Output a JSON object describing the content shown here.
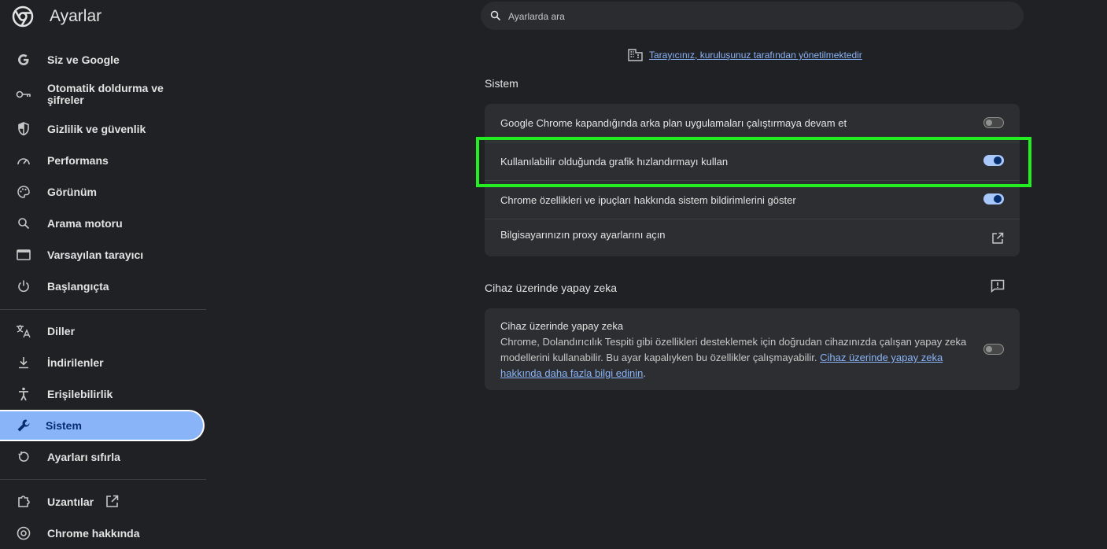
{
  "app": {
    "title": "Ayarlar"
  },
  "search": {
    "placeholder": "Ayarlarda ara"
  },
  "managed_notice": "Tarayıcınız, kuruluşunuz tarafından yönetilmektedir",
  "sidebar": {
    "items": [
      {
        "label": "Siz ve Google",
        "icon": "google-g-icon"
      },
      {
        "label": "Otomatik doldurma ve şifreler",
        "icon": "key-icon"
      },
      {
        "label": "Gizlilik ve güvenlik",
        "icon": "shield-icon"
      },
      {
        "label": "Performans",
        "icon": "speedometer-icon"
      },
      {
        "label": "Görünüm",
        "icon": "palette-icon"
      },
      {
        "label": "Arama motoru",
        "icon": "search-icon"
      },
      {
        "label": "Varsayılan tarayıcı",
        "icon": "browser-window-icon"
      },
      {
        "label": "Başlangıçta",
        "icon": "power-icon"
      },
      {
        "label": "Diller",
        "icon": "translate-icon"
      },
      {
        "label": "İndirilenler",
        "icon": "download-icon"
      },
      {
        "label": "Erişilebilirlik",
        "icon": "accessibility-icon"
      },
      {
        "label": "Sistem",
        "icon": "wrench-icon",
        "active": true
      },
      {
        "label": "Ayarları sıfırla",
        "icon": "reset-icon"
      },
      {
        "label": "Uzantılar",
        "icon": "puzzle-icon"
      },
      {
        "label": "Chrome hakkında",
        "icon": "chrome-icon"
      }
    ]
  },
  "system_section": {
    "title": "Sistem",
    "rows": [
      {
        "label": "Google Chrome kapandığında arka plan uygulamaları çalıştırmaya devam et",
        "state": "off"
      },
      {
        "label": "Kullanılabilir olduğunda grafik hızlandırmayı kullan",
        "state": "on"
      },
      {
        "label": "Chrome özellikleri ve ipuçları hakkında sistem bildirimlerini göster",
        "state": "on"
      },
      {
        "label": "Bilgisayarınızın proxy ayarlarını açın",
        "icon": "open-external-icon"
      }
    ]
  },
  "ai_section": {
    "title": "Cihaz üzerinde yapay zeka",
    "row_title": "Cihaz üzerinde yapay zeka",
    "description": "Chrome, Dolandırıcılık Tespiti gibi özellikleri desteklemek için doğrudan cihazınızda çalışan yapay zeka modellerini kullanabilir. Bu ayar kapalıyken bu özellikler çalışmayabilir.",
    "link": "Cihaz üzerinde yapay zeka hakkında daha fazla bilgi edinin",
    "link_suffix": ".",
    "state": "off"
  },
  "colors": {
    "accent": "#8ab4f8",
    "background": "#202124",
    "card": "#2d2e31",
    "highlight": "#22ee22"
  }
}
